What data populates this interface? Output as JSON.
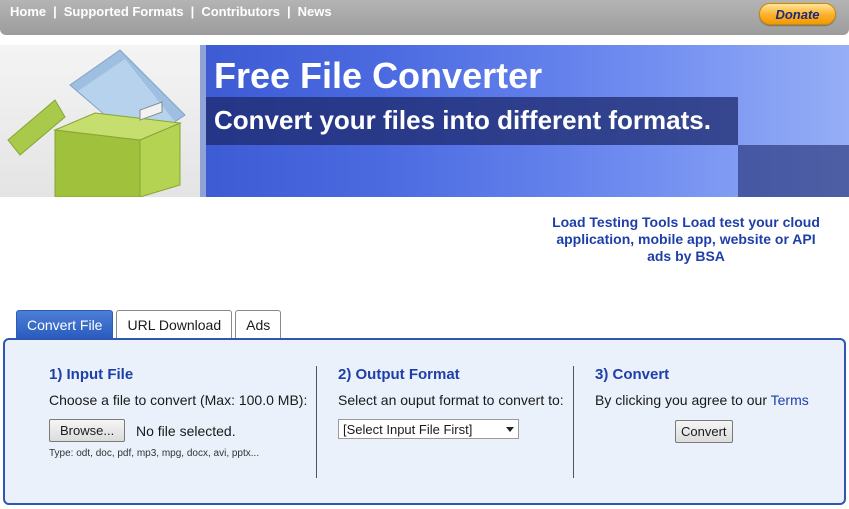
{
  "nav": {
    "items": [
      "Home",
      "Supported Formats",
      "Contributors",
      "News"
    ],
    "separator": "|",
    "donate_label": "Donate"
  },
  "banner": {
    "title": "Free File Converter",
    "subtitle": "Convert your files into different formats."
  },
  "ad": {
    "text": "Load Testing Tools Load test your cloud application, mobile app, website or API",
    "by": "ads by BSA"
  },
  "tabs": [
    {
      "label": "Convert File",
      "active": true
    },
    {
      "label": "URL Download",
      "active": false
    },
    {
      "label": "Ads",
      "active": false
    }
  ],
  "input_file": {
    "heading": "1) Input File",
    "desc": "Choose a file to convert (Max: 100.0 MB):",
    "browse_label": "Browse...",
    "no_file": "No file selected.",
    "types": "Type: odt, doc, pdf, mp3, mpg, docx, avi, pptx..."
  },
  "output_format": {
    "heading": "2) Output Format",
    "desc": "Select an ouput format to convert to:",
    "selected": "[Select Input File First]"
  },
  "convert": {
    "heading": "3) Convert",
    "desc_prefix": "By clicking you agree to our",
    "terms_label": "Terms",
    "button_label": "Convert"
  },
  "colors": {
    "accent": "#1f3fa8",
    "panel_bg": "#eaf1fb",
    "tab_active": "#2a5cbf",
    "donate": "#fbb02a"
  }
}
